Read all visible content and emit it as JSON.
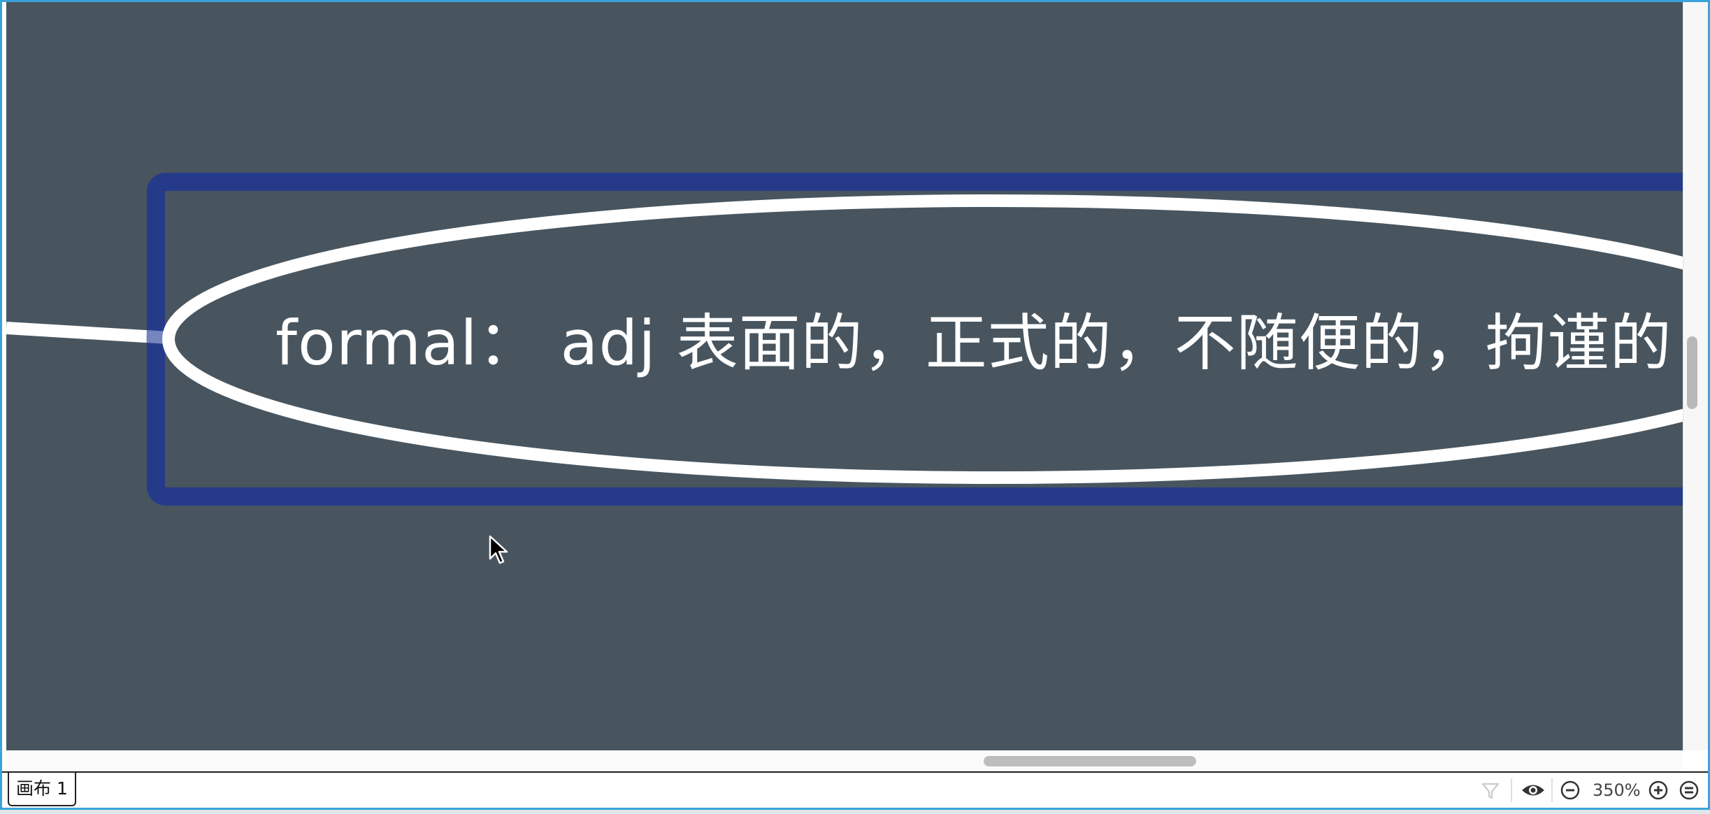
{
  "canvas": {
    "background_color": "#48555f",
    "topic": {
      "text": "formal： adj 表面的，正式的，不随便的，拘谨的",
      "text_color": "#ffffff",
      "outline_color": "#ffffff",
      "selection_color": "#253b8a"
    }
  },
  "statusbar": {
    "sheet_tab_label": "画布 1",
    "filter_icon": "filter-icon",
    "view_icon": "eye-icon",
    "zoom_out_icon": "zoom-out-icon",
    "zoom_level": "350%",
    "zoom_in_icon": "zoom-in-icon",
    "fit_icon": "fit-to-window-icon"
  }
}
